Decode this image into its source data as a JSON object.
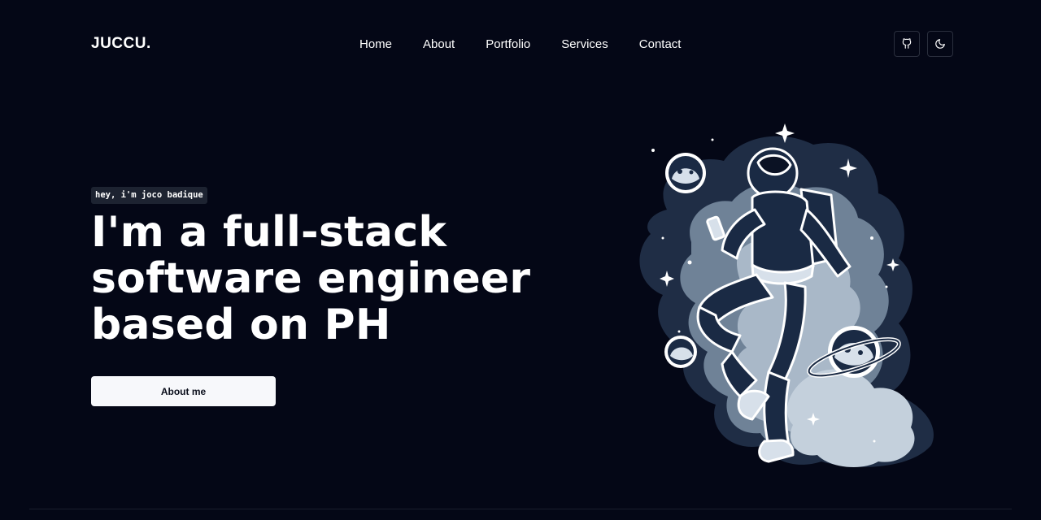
{
  "header": {
    "logo": "JUCCU.",
    "nav": [
      "Home",
      "About",
      "Portfolio",
      "Services",
      "Contact"
    ],
    "icons": [
      "github-icon",
      "moon-icon"
    ]
  },
  "hero": {
    "intro": "hey, i'm joco badique",
    "headline": [
      "I'm a full-stack",
      "software engineer",
      "based on PH"
    ],
    "cta_label": "About me"
  },
  "colors": {
    "background": "#040716",
    "text": "#ffffff",
    "button_bg": "#f7f8fb",
    "tag_bg": "#1d2331",
    "illustration_cloud": "#a9b8c8",
    "illustration_suit": "#1a2a44"
  }
}
